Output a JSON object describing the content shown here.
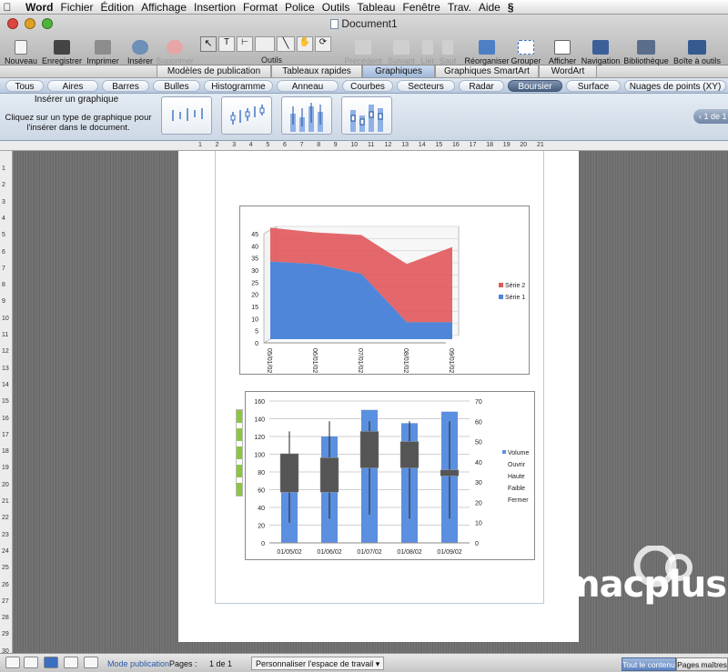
{
  "menubar": {
    "apple": "",
    "items": [
      "Word",
      "Fichier",
      "Édition",
      "Affichage",
      "Insertion",
      "Format",
      "Police",
      "Outils",
      "Tableau",
      "Fenêtre",
      "Trav.",
      "Aide"
    ],
    "script_icon": "script-menu-icon"
  },
  "window": {
    "title": "Document1",
    "colors": {
      "close": "#e0443e",
      "minimize": "#dea123",
      "zoom": "#4fb43c"
    }
  },
  "toolbar": {
    "nouveau": "Nouveau",
    "enregistrer": "Enregistrer",
    "imprimer": "Imprimer",
    "inserer": "Insérer",
    "supprimer": "Supprimer",
    "outils": "Outils",
    "precedent": "Précédent",
    "suivant": "Suivant",
    "lier": "Lier",
    "saut": "Saut",
    "reorganiser": "Réorganiser",
    "grouper": "Grouper",
    "afficher": "Afficher",
    "navigation": "Navigation",
    "bibliotheque": "Bibliothèque",
    "boite": "Boîte à outils"
  },
  "gallery_tabs": [
    "Modèles de publication",
    "Tableaux rapides",
    "Graphiques",
    "Graphiques SmartArt",
    "WordArt"
  ],
  "gallery_tab_active": "Graphiques",
  "chart_types": [
    "Tous",
    "Aires",
    "Barres",
    "Bulles",
    "Histogramme",
    "Anneau",
    "Courbes",
    "Secteurs",
    "Radar",
    "Boursier",
    "Surface",
    "Nuages de points (XY)"
  ],
  "chart_type_active": "Boursier",
  "gallery": {
    "title": "Insérer un graphique",
    "help": "Cliquez sur un type de graphique pour l'insérer dans le document.",
    "pager": "1 de 1"
  },
  "ruler": {
    "h": [
      "1",
      "2",
      "3",
      "4",
      "5",
      "6",
      "7",
      "8",
      "9",
      "10",
      "11",
      "12",
      "13",
      "14",
      "15",
      "16",
      "17",
      "18",
      "19",
      "20",
      "21"
    ],
    "v": [
      "1",
      "2",
      "3",
      "4",
      "5",
      "6",
      "7",
      "8",
      "9",
      "10",
      "11",
      "12",
      "13",
      "14",
      "15",
      "16",
      "17",
      "18",
      "19",
      "20",
      "21",
      "22",
      "23",
      "24",
      "25",
      "26",
      "27",
      "28",
      "29",
      "30"
    ]
  },
  "chart_data": [
    {
      "type": "area",
      "three_d": true,
      "categories": [
        "05/01/02",
        "06/01/02",
        "07/01/02",
        "08/01/02",
        "09/01/02"
      ],
      "category_display": [
        "/10\n05",
        "/10\n90",
        "/10\n/10",
        "20\n/10",
        "/10\n20"
      ],
      "series": [
        {
          "name": "Série 1",
          "values": [
            32,
            31,
            27,
            7,
            7
          ],
          "color": "#4f86d9"
        },
        {
          "name": "Série 2",
          "values": [
            14,
            13,
            16,
            24,
            31
          ],
          "color": "#e0575b"
        }
      ],
      "ylim": [
        0,
        45
      ],
      "yticks": [
        "0",
        "5",
        "10",
        "15",
        "20",
        "25",
        "30",
        "35",
        "40",
        "45"
      ],
      "legend": "right",
      "legend_entries": [
        "Série 2",
        "Série 1"
      ]
    },
    {
      "type": "stock",
      "categories": [
        "01/05/02",
        "01/06/02",
        "01/07/02",
        "01/08/02",
        "01/09/02"
      ],
      "ylim_left": [
        0,
        160
      ],
      "ylim_right": [
        0,
        70
      ],
      "yticks_left": [
        "0",
        "20",
        "40",
        "60",
        "80",
        "100",
        "120",
        "140",
        "160"
      ],
      "yticks_right": [
        "0",
        "10",
        "20",
        "30",
        "40",
        "50",
        "60",
        "70"
      ],
      "volume": [
        100,
        120,
        150,
        135,
        148
      ],
      "ouvrir": [
        44,
        42,
        55,
        50,
        36
      ],
      "haute": [
        55,
        60,
        60,
        60,
        60
      ],
      "faible": [
        10,
        12,
        14,
        12,
        12
      ],
      "fermer": [
        25,
        25,
        37,
        37,
        33
      ],
      "legend": "right",
      "legend_entries": [
        "Volume",
        "Ouvrir",
        "Haute",
        "Faible",
        "Fermer"
      ],
      "colors": {
        "volume": "#5b8fdf",
        "up": "#ffffff",
        "down": "#555555"
      }
    }
  ],
  "watermark": "macplus",
  "status": {
    "mode": "Mode publication",
    "pages_label": "Pages :",
    "pages_value": "1 de 1",
    "customize": "Personnaliser l'espace de travail",
    "tout": "Tout le contenu",
    "pages_maitres": "Pages maîtres"
  }
}
